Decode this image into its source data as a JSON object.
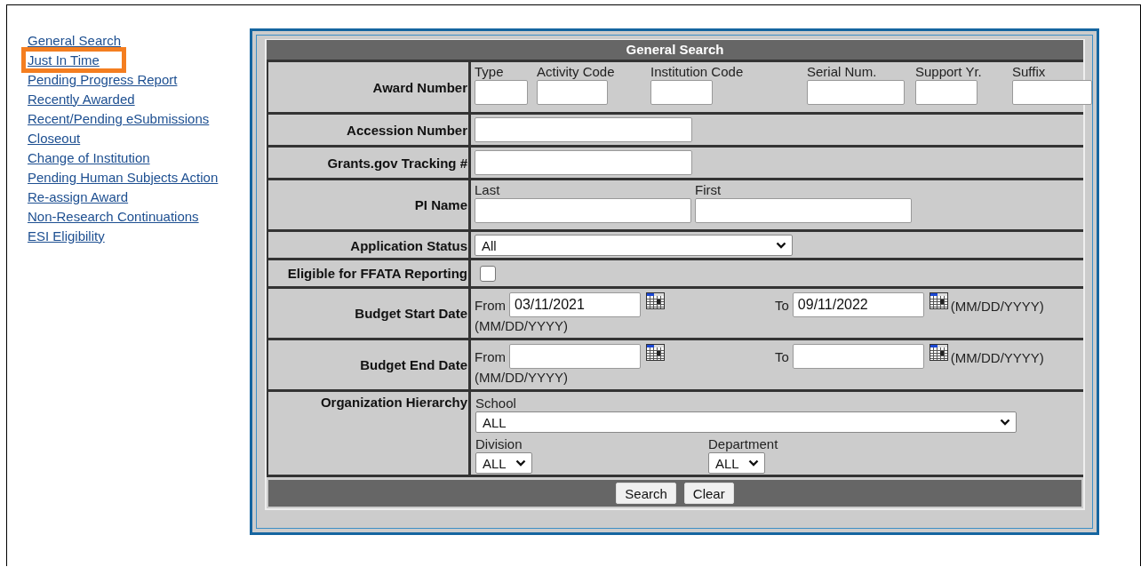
{
  "sidebar": {
    "items": [
      {
        "label": "General Search",
        "highlighted": false
      },
      {
        "label": "Just In Time",
        "highlighted": true
      },
      {
        "label": "Pending Progress Report",
        "highlighted": false
      },
      {
        "label": "Recently Awarded",
        "highlighted": false
      },
      {
        "label": "Recent/Pending eSubmissions",
        "highlighted": false
      },
      {
        "label": "Closeout",
        "highlighted": false
      },
      {
        "label": "Change of Institution",
        "highlighted": false
      },
      {
        "label": "Pending Human Subjects Action",
        "highlighted": false
      },
      {
        "label": "Re-assign Award",
        "highlighted": false
      },
      {
        "label": "Non-Research Continuations",
        "highlighted": false
      },
      {
        "label": "ESI Eligibility",
        "highlighted": false
      }
    ]
  },
  "form": {
    "title": "General Search",
    "rows": [
      {
        "kind": "award",
        "label": "Award Number",
        "fields": [
          {
            "label": "Type"
          },
          {
            "label": "Activity Code"
          },
          {
            "label": "Institution Code"
          },
          {
            "label": "Serial Num."
          },
          {
            "label": "Support Yr."
          },
          {
            "label": "Suffix"
          }
        ]
      },
      {
        "kind": "text",
        "label": "Accession Number"
      },
      {
        "kind": "text",
        "label": "Grants.gov Tracking #"
      },
      {
        "kind": "name",
        "label": "PI Name",
        "fields": [
          {
            "label": "Last"
          },
          {
            "label": "First"
          }
        ]
      },
      {
        "kind": "select",
        "label": "Application Status",
        "value": "All"
      },
      {
        "kind": "checkbox",
        "label": "Eligible for FFATA Reporting",
        "checked": false
      },
      {
        "kind": "daterange",
        "label": "Budget Start Date",
        "from_label": "From",
        "from_value": "03/11/2021",
        "to_label": "To",
        "to_value": "09/11/2022",
        "format_below": "(MM/DD/YYYY)",
        "format_right": "(MM/DD/YYYY)"
      },
      {
        "kind": "daterange",
        "label": "Budget End Date",
        "from_label": "From",
        "to_label": "To",
        "format_below": "(MM/DD/YYYY)",
        "format_right": "(MM/DD/YYYY)"
      },
      {
        "kind": "org",
        "label": "Organization Hierarchy",
        "school": {
          "label": "School",
          "value": "ALL"
        },
        "division": {
          "label": "Division",
          "value": "ALL"
        },
        "department": {
          "label": "Department",
          "value": "ALL"
        }
      }
    ],
    "buttons": [
      "Search",
      "Clear"
    ]
  }
}
